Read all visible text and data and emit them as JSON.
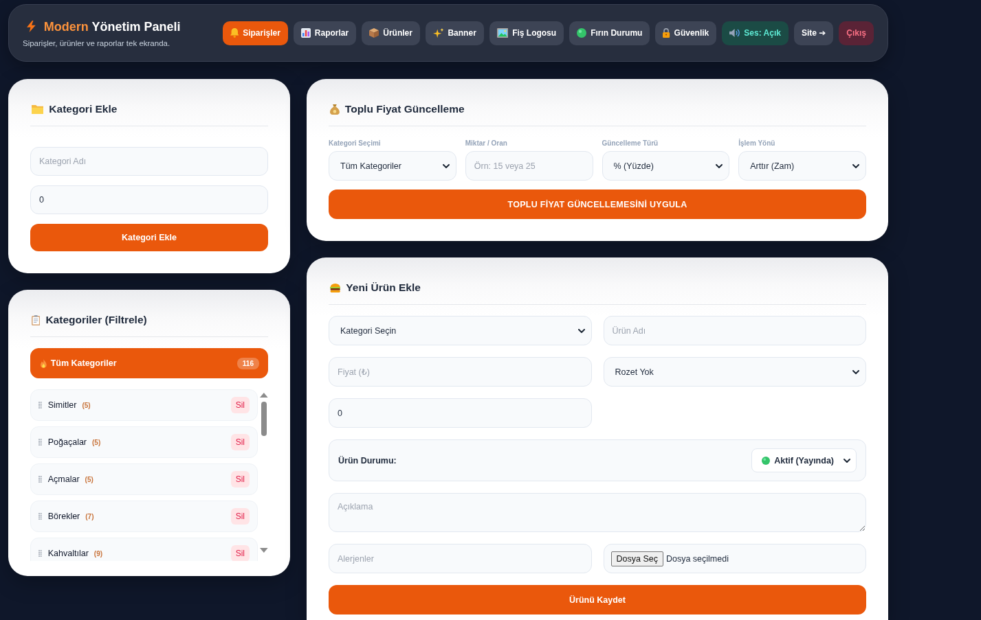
{
  "header": {
    "title_accent": "Modern",
    "title_rest": "Yönetim Paneli",
    "subtitle": "Siparişler, ürünler ve raporlar tek ekranda."
  },
  "nav_tabs": [
    {
      "label": "Siparişler",
      "selected": true
    },
    {
      "label": "Raporlar",
      "selected": false
    },
    {
      "label": "Ürünler",
      "selected": false
    },
    {
      "label": "Banner",
      "selected": false
    },
    {
      "label": "Fiş Logosu",
      "selected": false
    },
    {
      "label": "Fırın Durumu",
      "selected": false
    },
    {
      "label": "Güvenlik",
      "selected": false
    }
  ],
  "sound_toggle": {
    "label": "Ses: Açık",
    "on": true
  },
  "site_link": {
    "label": "Site ➔"
  },
  "logout_button": {
    "label": "Çıkış"
  },
  "category_form": {
    "title": "Kategori Ekle",
    "name_placeholder": "Kategori Adı",
    "order_value": "0",
    "submit": "Kategori Ekle"
  },
  "category_filter": {
    "title": "Kategoriler (Filtrele)",
    "all": {
      "label": "Tüm Kategoriler",
      "count": "116",
      "selected": true
    },
    "items": [
      {
        "name": "Simitler",
        "count": "(5)",
        "delete": "Sil",
        "selected": false
      },
      {
        "name": "Poğaçalar",
        "count": "(5)",
        "delete": "Sil",
        "selected": false
      },
      {
        "name": "Açmalar",
        "count": "(5)",
        "delete": "Sil",
        "selected": false
      },
      {
        "name": "Börekler",
        "count": "(7)",
        "delete": "Sil",
        "selected": false
      },
      {
        "name": "Kahvaltılar",
        "count": "(9)",
        "delete": "Sil",
        "selected": false
      }
    ]
  },
  "bulk_price": {
    "title": "Toplu Fiyat Güncelleme",
    "fields": [
      {
        "kind": "select",
        "label": "Kategori Seçimi",
        "value": "Tüm Kategoriler"
      },
      {
        "kind": "input",
        "label": "Miktar / Oran",
        "placeholder": "Örn: 15 veya 25"
      },
      {
        "kind": "select",
        "label": "Güncelleme Türü",
        "value": "% (Yüzde)"
      },
      {
        "kind": "select",
        "label": "İşlem Yönü",
        "value": "Arttır (Zam)"
      }
    ],
    "submit": "TOPLU FİYAT GÜNCELLEMESİNİ UYGULA"
  },
  "product_form": {
    "title": "Yeni Ürün Ekle",
    "fields": [
      {
        "kind": "select",
        "value": "Kategori Seçin"
      },
      {
        "kind": "input",
        "placeholder": "Ürün Adı"
      },
      {
        "kind": "input",
        "placeholder": "Fiyat (₺)"
      },
      {
        "kind": "select",
        "value": "Rozet Yok"
      },
      {
        "kind": "input",
        "value": "0"
      }
    ],
    "status": {
      "label": "Ürün Durumu:",
      "value": "Aktif (Yayında)"
    },
    "description_placeholder": "Açıklama",
    "allergens_placeholder": "Alerjenler",
    "file": {
      "button": "Dosya Seç",
      "status": "Dosya seçilmedi"
    },
    "submit": "Ürünü Kaydet"
  }
}
